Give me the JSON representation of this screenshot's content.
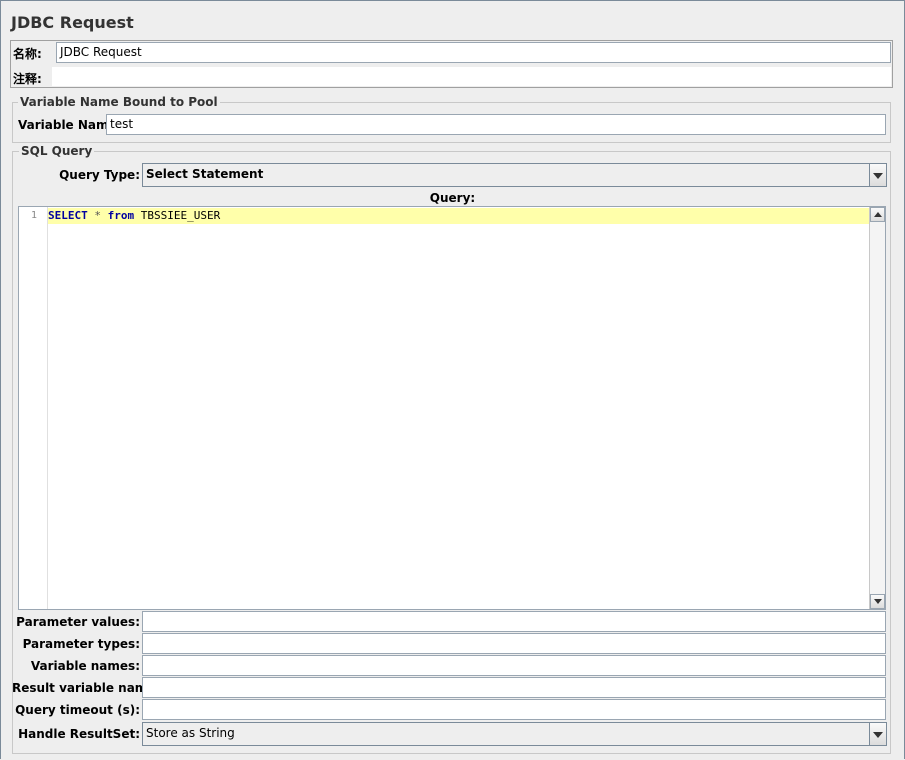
{
  "panel": {
    "title": "JDBC Request"
  },
  "name_section": {
    "name_label": "名称:",
    "name_value": "JDBC Request",
    "comment_label": "注释:",
    "comment_value": ""
  },
  "pool_section": {
    "legend": "Variable Name Bound to Pool",
    "variable_label": "Variable Name:",
    "variable_value": "test"
  },
  "sql_section": {
    "legend": "SQL Query",
    "query_type_label": "Query Type:",
    "query_type_value": "Select Statement",
    "query_label": "Query:",
    "editor": {
      "line_numbers": [
        "1"
      ],
      "code_tokens": [
        "SELECT",
        "*",
        "from",
        "TBSSIEE_USER"
      ]
    },
    "params": [
      {
        "label": "Parameter values:",
        "value": ""
      },
      {
        "label": "Parameter types:",
        "value": ""
      },
      {
        "label": "Variable names:",
        "value": ""
      },
      {
        "label": "Result variable name:",
        "value": ""
      },
      {
        "label": "Query timeout (s):",
        "value": ""
      }
    ],
    "handle_resultset_label": "Handle ResultSet:",
    "handle_resultset_value": "Store as String"
  },
  "icons": {
    "query_type_dropdown": "chevron-down-icon",
    "resultset_dropdown": "chevron-down-icon",
    "scroll_up": "arrow-up-icon",
    "scroll_down": "arrow-down-icon"
  },
  "colors": {
    "background": "#eeeeee",
    "line_highlight": "#ffffaa",
    "sql_keyword": "#0000a0",
    "border": "#7a8a99"
  }
}
